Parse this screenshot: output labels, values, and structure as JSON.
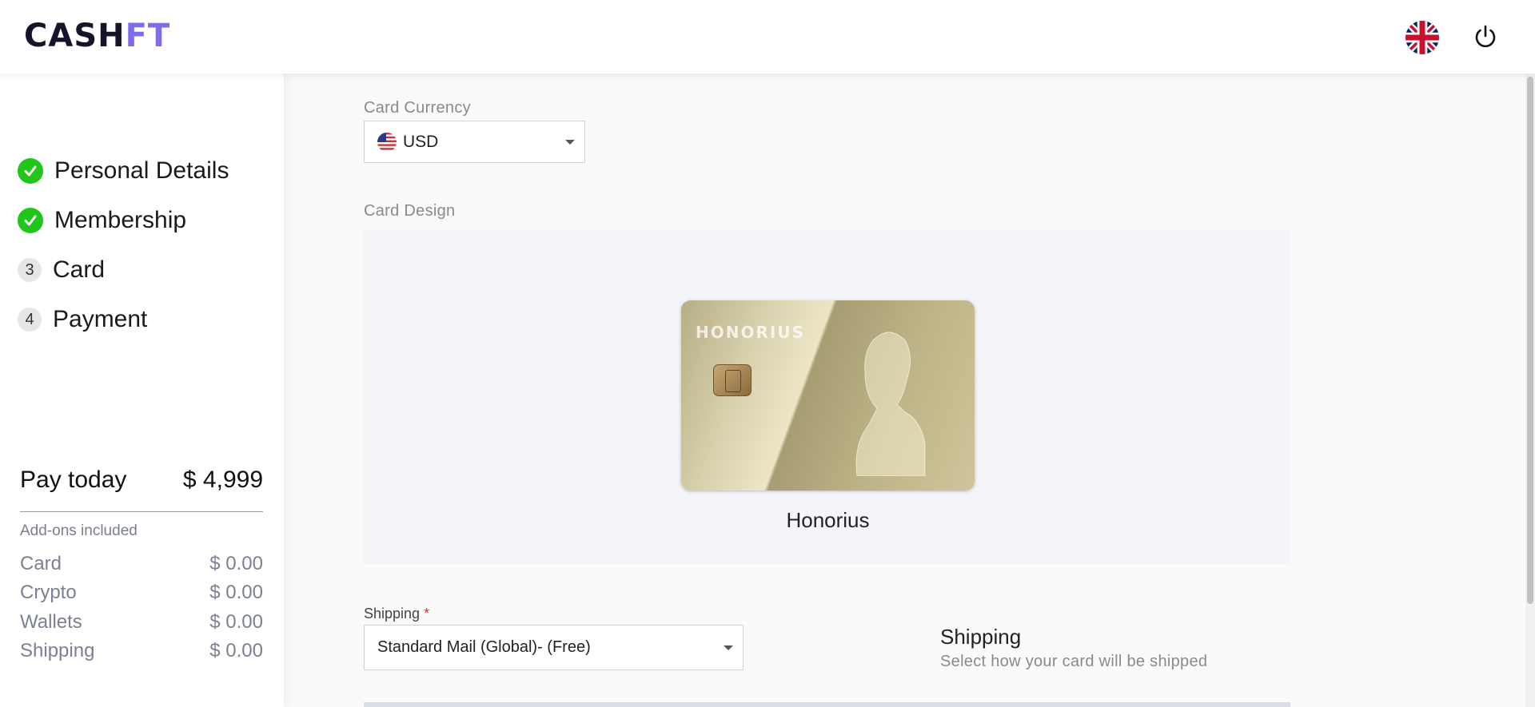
{
  "header": {
    "logo_main": "CASH",
    "logo_accent": "FT",
    "language_icon": "uk-flag-icon",
    "power_icon": "power-icon"
  },
  "sidebar": {
    "steps": [
      {
        "label": "Personal Details",
        "status": "done",
        "marker": ""
      },
      {
        "label": "Membership",
        "status": "done",
        "marker": ""
      },
      {
        "label": "Card",
        "status": "pending",
        "marker": "3"
      },
      {
        "label": "Payment",
        "status": "pending",
        "marker": "4"
      }
    ],
    "pay_today_label": "Pay today",
    "pay_today_value": "$ 4,999",
    "addons_label": "Add-ons included",
    "addons": [
      {
        "label": "Card",
        "value": "$ 0.00"
      },
      {
        "label": "Crypto",
        "value": "$ 0.00"
      },
      {
        "label": "Wallets",
        "value": "$ 0.00"
      },
      {
        "label": "Shipping",
        "value": "$ 0.00"
      }
    ]
  },
  "main": {
    "currency_label": "Card Currency",
    "currency_value": "USD",
    "currency_flag_icon": "us-flag-icon",
    "design_label": "Card Design",
    "card": {
      "brand_text": "HONORIUS",
      "name": "Honorius"
    },
    "shipping_label": "Shipping",
    "shipping_required_mark": "*",
    "shipping_value": "Standard Mail (Global)- (Free)",
    "shipping_title": "Shipping",
    "shipping_subtitle": "Select how your card will be shipped"
  },
  "colors": {
    "accent": "#7b6cf0",
    "done_green": "#22c51a",
    "required_red": "#e03131"
  }
}
